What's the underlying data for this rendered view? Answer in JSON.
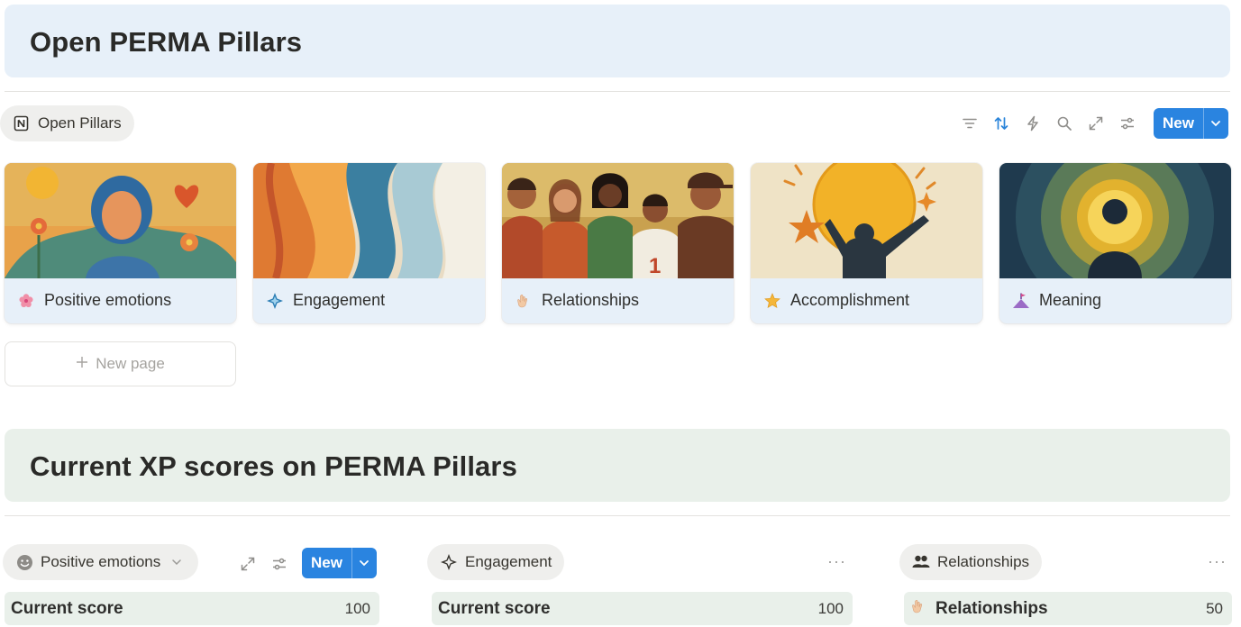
{
  "pillars_section": {
    "title": "Open PERMA Pillars",
    "view_tab": {
      "label": "Open Pillars",
      "icon": "notion-icon"
    },
    "toolbar": {
      "icons": [
        "filter-icon",
        "sort-icon",
        "automation-icon",
        "search-icon",
        "expand-icon",
        "settings-icon"
      ],
      "new_label": "New"
    },
    "cards": [
      {
        "title": "Positive emotions",
        "icon": "cherry-blossom-icon"
      },
      {
        "title": "Engagement",
        "icon": "compass-icon"
      },
      {
        "title": "Relationships",
        "icon": "handshake-icon"
      },
      {
        "title": "Accomplishment",
        "icon": "star-icon"
      },
      {
        "title": "Meaning",
        "icon": "mountain-flag-icon"
      }
    ],
    "new_page_label": "New page"
  },
  "scores_section": {
    "title": "Current XP scores on PERMA Pillars",
    "panels": [
      {
        "tab_label": "Positive emotions",
        "new_label": "New",
        "row_label": "Current score",
        "row_value": "100"
      },
      {
        "tab_label": "Engagement",
        "row_label": "Current score",
        "row_value": "100"
      },
      {
        "tab_label": "Relationships",
        "row_label": "Relationships",
        "row_value": "50"
      }
    ]
  },
  "colors": {
    "accent": "#2a84e0",
    "callout_blue": "#e7f0f9",
    "callout_green": "#e9f0ea"
  }
}
